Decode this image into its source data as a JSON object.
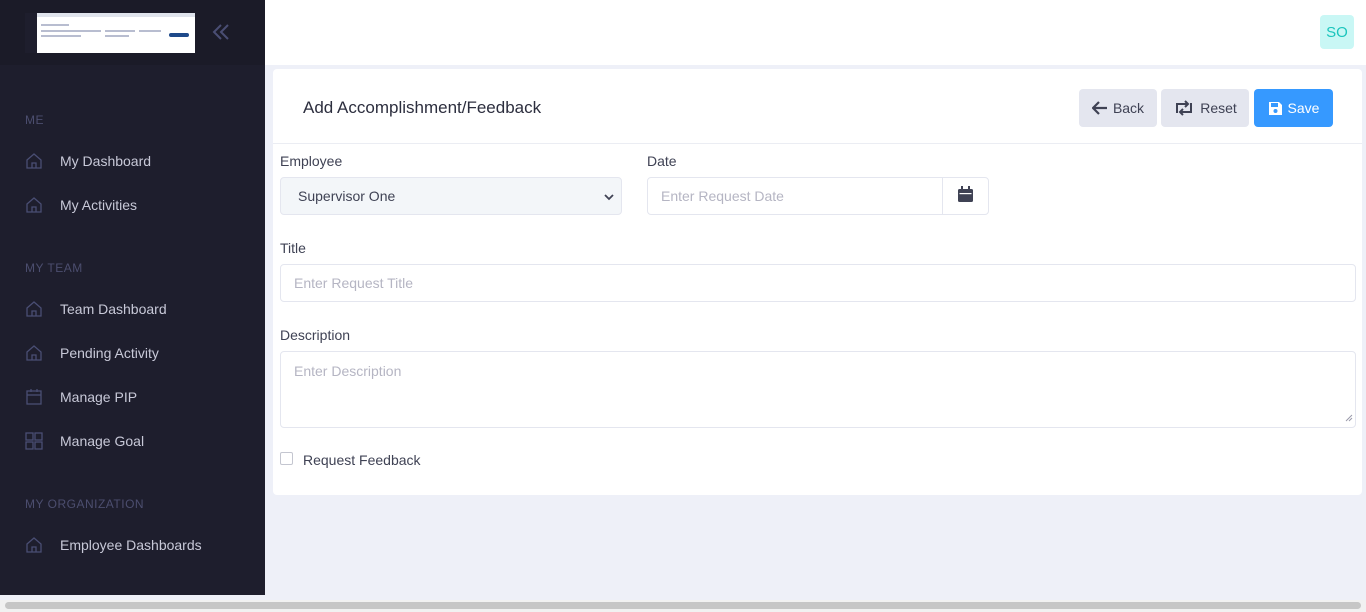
{
  "sidebar": {
    "sections": {
      "me": "ME",
      "my_team": "MY TEAM",
      "my_org": "MY ORGANIZATION"
    },
    "items": [
      {
        "label": "My Dashboard",
        "icon": "home-icon"
      },
      {
        "label": "My Activities",
        "icon": "home-icon"
      },
      {
        "label": "Team Dashboard",
        "icon": "home-icon"
      },
      {
        "label": "Pending Activity",
        "icon": "home-icon"
      },
      {
        "label": "Manage PIP",
        "icon": "calendar-icon"
      },
      {
        "label": "Manage Goal",
        "icon": "grid-icon"
      },
      {
        "label": "Employee Dashboards",
        "icon": "home-icon"
      }
    ]
  },
  "topbar": {
    "avatar_initials": "SO"
  },
  "form": {
    "title": "Add Accomplishment/Feedback",
    "buttons": {
      "back": "Back",
      "reset": "Reset",
      "save": "Save"
    },
    "employee_label": "Employee",
    "employee_value": "Supervisor One",
    "date_label": "Date",
    "date_placeholder": "Enter Request Date",
    "title_label": "Title",
    "title_placeholder": "Enter Request Title",
    "description_label": "Description",
    "description_placeholder": "Enter Description",
    "request_feedback_label": "Request Feedback"
  },
  "colors": {
    "sidebar_bg": "#1e1e2d",
    "primary": "#3699ff",
    "avatar_bg": "#c9f7f5",
    "avatar_fg": "#1bc5bd"
  }
}
